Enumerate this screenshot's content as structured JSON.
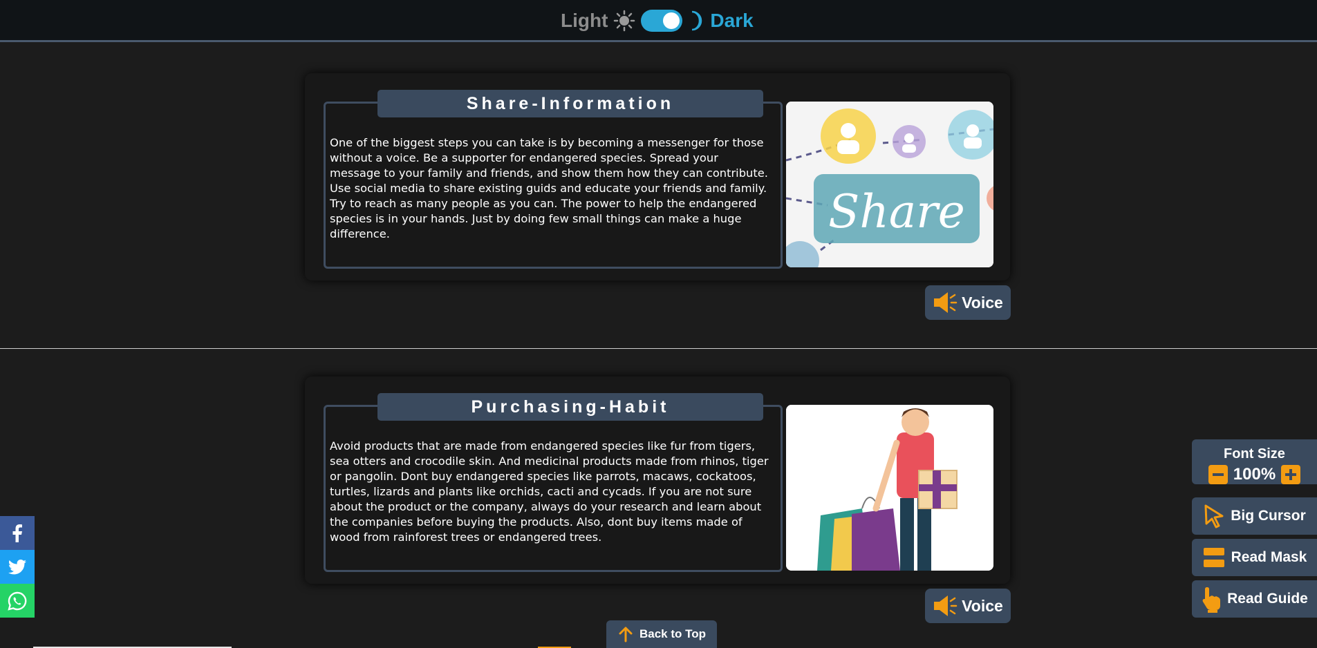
{
  "theme": {
    "light_label": "Light",
    "dark_label": "Dark",
    "mode": "dark"
  },
  "sections": [
    {
      "title": "Share-Information",
      "text": "One of the biggest steps you can take is by becoming a messenger for those without a voice. Be a supporter for endangered species. Spread your message to your family and friends, and show them how they can contribute. Use social media to share existing guids and educate your friends and family. Try to reach as many people as you can. The power to help the endangered species is in your hands. Just by doing few small things can make a huge difference.",
      "image_word": "Share",
      "voice_label": "Voice"
    },
    {
      "title": "Purchasing-Habit",
      "text": "Avoid products that are made from endangered species like fur from tigers, sea otters and crocodile skin. And medicinal products made from rhinos, tiger or pangolin. Dont buy endangered species like parrots, macaws, cockatoos, turtles, lizards and plants like orchids, cacti and cycads. If you are not sure about the product or the company, always do your research and learn about the companies before buying the products. Also, dont buy items made of wood from rainforest trees or endangered trees.",
      "voice_label": "Voice"
    }
  ],
  "social": [
    "facebook-icon",
    "twitter-icon",
    "whatsapp-icon"
  ],
  "accessibility": {
    "font_size_label": "Font Size",
    "font_size_value": "100%",
    "big_cursor_label": "Big Cursor",
    "read_mask_label": "Read Mask",
    "read_guide_label": "Read Guide"
  },
  "back_to_top": "Back to Top",
  "colors": {
    "accent_blue": "#2aa7d6",
    "accent_orange": "#f39c12",
    "panel": "#3a4a5e",
    "background": "#1c1c1c"
  }
}
